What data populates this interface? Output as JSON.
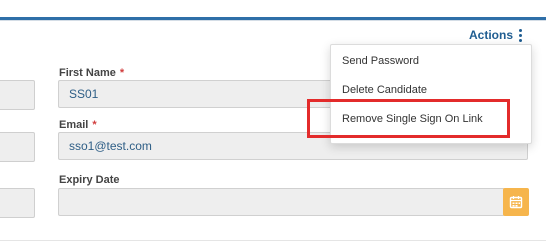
{
  "header": {
    "actions_label": "Actions"
  },
  "menu": {
    "items": [
      {
        "label": "Send Password"
      },
      {
        "label": "Delete Candidate"
      },
      {
        "label": "Remove Single Sign On Link"
      }
    ]
  },
  "form": {
    "first_name": {
      "label": "First Name",
      "required": "*",
      "value": "SS01"
    },
    "email": {
      "label": "Email",
      "required": "*",
      "value": "sso1@test.com"
    },
    "expiry": {
      "label": "Expiry Date",
      "value": ""
    }
  },
  "icons": {
    "kebab": "more-vertical-icon",
    "calendar": "calendar-icon"
  },
  "colors": {
    "accent_blue": "#1f5d91",
    "required_red": "#d13d3d",
    "calendar_orange": "#f6b54c",
    "highlight_red": "#e32b2b"
  }
}
